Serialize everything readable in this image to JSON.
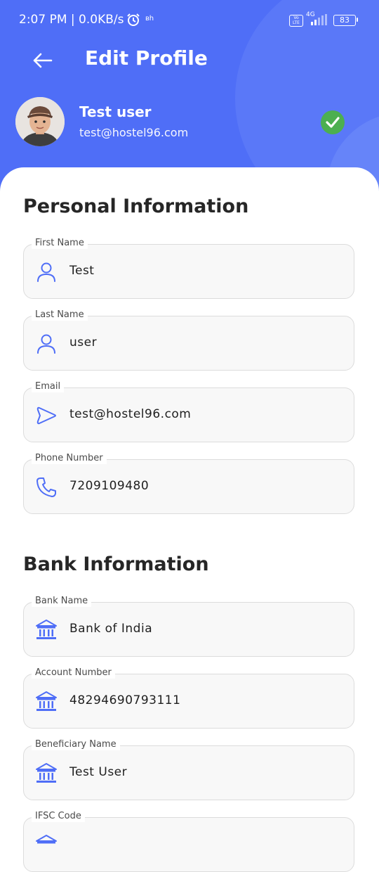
{
  "status_bar": {
    "time": "2:07 PM | 0.0KB/s",
    "net_meter": "ʙh",
    "volte": "Vo LTE",
    "network": "4G",
    "battery": "83"
  },
  "header": {
    "title": "Edit Profile",
    "user_name": "Test user",
    "user_email": "test@hostel96.com"
  },
  "personal": {
    "title": "Personal Information",
    "fields": [
      {
        "label": "First Name",
        "value": "Test",
        "icon": "person-icon"
      },
      {
        "label": "Last Name",
        "value": "user",
        "icon": "person-icon"
      },
      {
        "label": "Email",
        "value": "test@hostel96.com",
        "icon": "send-icon"
      },
      {
        "label": "Phone Number",
        "value": "7209109480",
        "icon": "phone-icon"
      }
    ]
  },
  "bank": {
    "title": "Bank Information",
    "fields": [
      {
        "label": "Bank Name",
        "value": "Bank of India",
        "icon": "bank-icon"
      },
      {
        "label": "Account Number",
        "value": "48294690793111",
        "icon": "bank-icon"
      },
      {
        "label": "Beneficiary Name",
        "value": "Test User",
        "icon": "bank-icon"
      },
      {
        "label": "IFSC Code",
        "value": "",
        "icon": "bank-icon"
      }
    ]
  },
  "colors": {
    "primary": "#4f6ef7",
    "icon": "#4f6ef7",
    "verified": "#4caf50"
  }
}
